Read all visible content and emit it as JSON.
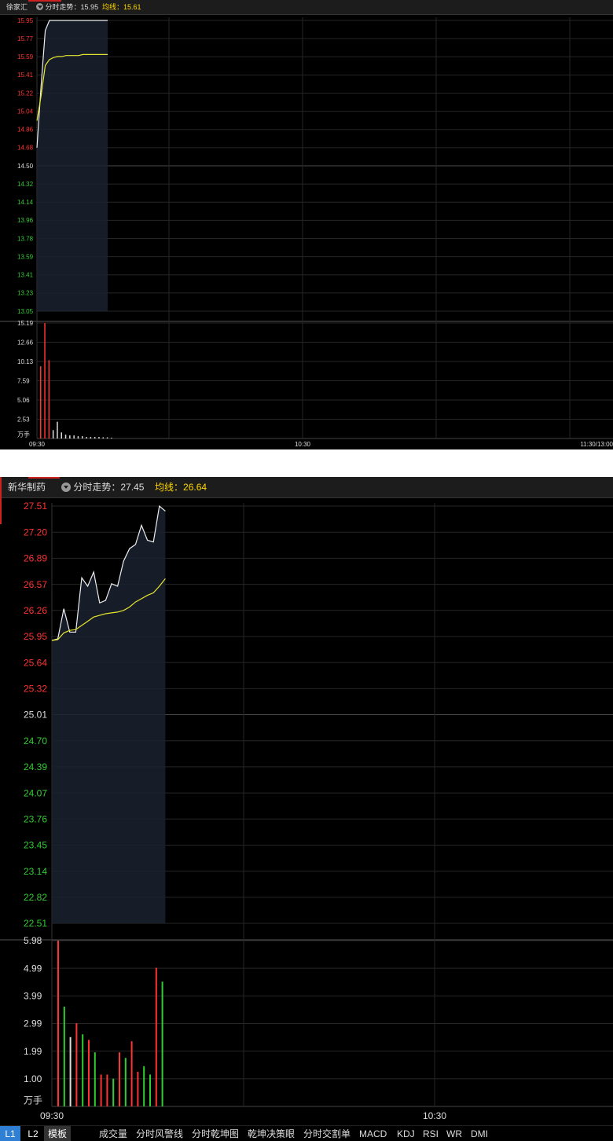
{
  "panel1": {
    "stock_name": "徐家汇",
    "trend_label": "分时走势",
    "trend_value": "15.95",
    "avg_label": "均线",
    "avg_value": "15.61",
    "price_ticks": [
      {
        "label": "15.95",
        "color": "#ff3333"
      },
      {
        "label": "15.77",
        "color": "#ff3333"
      },
      {
        "label": "15.59",
        "color": "#ff3333"
      },
      {
        "label": "15.41",
        "color": "#ff3333"
      },
      {
        "label": "15.22",
        "color": "#ff3333"
      },
      {
        "label": "15.04",
        "color": "#ff3333"
      },
      {
        "label": "14.86",
        "color": "#ff3333"
      },
      {
        "label": "14.68",
        "color": "#ff3333"
      },
      {
        "label": "14.50",
        "color": "#dddddd"
      },
      {
        "label": "14.32",
        "color": "#33cc33"
      },
      {
        "label": "14.14",
        "color": "#33cc33"
      },
      {
        "label": "13.96",
        "color": "#33cc33"
      },
      {
        "label": "13.78",
        "color": "#33cc33"
      },
      {
        "label": "13.59",
        "color": "#33cc33"
      },
      {
        "label": "13.41",
        "color": "#33cc33"
      },
      {
        "label": "13.23",
        "color": "#33cc33"
      },
      {
        "label": "13.05",
        "color": "#33cc33"
      }
    ],
    "volume_ticks": [
      "15.19",
      "12.66",
      "10.13",
      "7.59",
      "5.06",
      "2.53"
    ],
    "volume_unit": "万手",
    "time_labels": [
      "09:30",
      "10:30",
      "11:30/13:00"
    ],
    "chart_data": {
      "type": "line",
      "ylim": [
        13.05,
        15.95
      ],
      "price": [
        14.68,
        15.3,
        15.85,
        15.95,
        15.95,
        15.95,
        15.95,
        15.95,
        15.95,
        15.95,
        15.95,
        15.95,
        15.95,
        15.95,
        15.95,
        15.95,
        15.95,
        15.95
      ],
      "average": [
        14.95,
        15.2,
        15.5,
        15.56,
        15.58,
        15.59,
        15.59,
        15.6,
        15.6,
        15.6,
        15.6,
        15.61,
        15.61,
        15.61,
        15.61,
        15.61,
        15.61,
        15.61
      ],
      "volume_ylim": [
        0,
        15.19
      ],
      "volume": [
        9.5,
        15.19,
        10.3,
        1.1,
        2.2,
        0.8,
        0.5,
        0.4,
        0.4,
        0.3,
        0.3,
        0.2,
        0.2,
        0.2,
        0.2,
        0.15,
        0.15,
        0.1
      ],
      "volume_colors": [
        "#ff3333",
        "#ff3333",
        "#ff3333",
        "#dddddd",
        "#dddddd",
        "#dddddd",
        "#dddddd",
        "#dddddd",
        "#dddddd",
        "#dddddd",
        "#dddddd",
        "#dddddd",
        "#dddddd",
        "#dddddd",
        "#dddddd",
        "#dddddd",
        "#dddddd",
        "#dddddd"
      ]
    }
  },
  "panel2": {
    "stock_name": "新华制药",
    "trend_label": "分时走势",
    "trend_value": "27.45",
    "avg_label": "均线",
    "avg_value": "26.64",
    "price_ticks": [
      {
        "label": "27.51",
        "color": "#ff3333"
      },
      {
        "label": "27.20",
        "color": "#ff3333"
      },
      {
        "label": "26.89",
        "color": "#ff3333"
      },
      {
        "label": "26.57",
        "color": "#ff3333"
      },
      {
        "label": "26.26",
        "color": "#ff3333"
      },
      {
        "label": "25.95",
        "color": "#ff3333"
      },
      {
        "label": "25.64",
        "color": "#ff3333"
      },
      {
        "label": "25.32",
        "color": "#ff3333"
      },
      {
        "label": "25.01",
        "color": "#dddddd"
      },
      {
        "label": "24.70",
        "color": "#33cc33"
      },
      {
        "label": "24.39",
        "color": "#33cc33"
      },
      {
        "label": "24.07",
        "color": "#33cc33"
      },
      {
        "label": "23.76",
        "color": "#33cc33"
      },
      {
        "label": "23.45",
        "color": "#33cc33"
      },
      {
        "label": "23.14",
        "color": "#33cc33"
      },
      {
        "label": "22.82",
        "color": "#33cc33"
      },
      {
        "label": "22.51",
        "color": "#33cc33"
      }
    ],
    "volume_ticks": [
      "5.98",
      "4.99",
      "3.99",
      "2.99",
      "1.99",
      "1.00"
    ],
    "volume_unit": "万手",
    "time_labels": [
      "09:30",
      "10:30"
    ],
    "chart_data": {
      "type": "line",
      "ylim": [
        22.51,
        27.51
      ],
      "price": [
        25.9,
        25.92,
        26.28,
        26.0,
        26.0,
        26.65,
        26.55,
        26.72,
        26.35,
        26.38,
        26.58,
        26.55,
        26.85,
        27.0,
        27.05,
        27.28,
        27.1,
        27.08,
        27.51,
        27.45
      ],
      "average": [
        25.9,
        25.91,
        25.99,
        26.02,
        26.03,
        26.08,
        26.13,
        26.18,
        26.2,
        26.22,
        26.23,
        26.24,
        26.26,
        26.3,
        26.36,
        26.4,
        26.44,
        26.47,
        26.55,
        26.64
      ],
      "volume_ylim": [
        0,
        5.98
      ],
      "volume": [
        5.98,
        3.6,
        2.5,
        3.0,
        2.6,
        2.4,
        1.95,
        1.15,
        1.15,
        1.0,
        1.95,
        1.75,
        2.35,
        1.25,
        1.45,
        1.15,
        5.0,
        4.5
      ],
      "volume_colors": [
        "#ff3333",
        "#33cc33",
        "#dddddd",
        "#ff3333",
        "#33cc33",
        "#ff3333",
        "#33cc33",
        "#ff3333",
        "#ff3333",
        "#33cc33",
        "#ff3333",
        "#33cc33",
        "#ff3333",
        "#ff3333",
        "#33cc33",
        "#33cc33",
        "#ff3333",
        "#33cc33"
      ]
    }
  },
  "toolbar": {
    "l1": "L1",
    "l2": "L2",
    "template": "模板",
    "items": [
      "成交量",
      "分时风警线",
      "分时乾坤图",
      "乾坤决策眼",
      "分时交割单",
      "MACD",
      "KDJ",
      "RSI",
      "WR",
      "DMI"
    ]
  }
}
